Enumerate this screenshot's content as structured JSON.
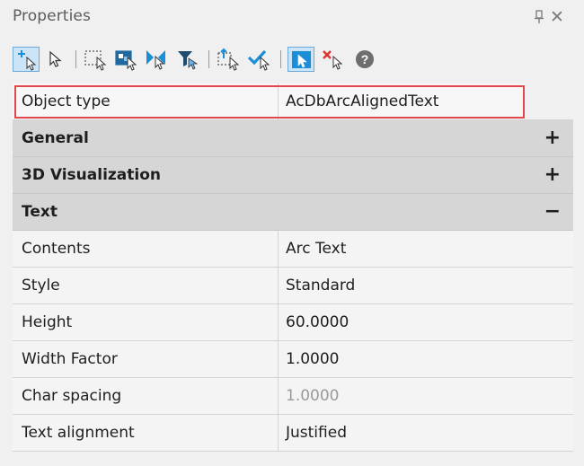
{
  "panel": {
    "title": "Properties",
    "pin_icon": "pin-icon",
    "close_label": "✕"
  },
  "toolbar": {
    "buttons": [
      {
        "name": "add-selection-icon",
        "active": false
      },
      {
        "name": "select-objects-icon",
        "active": false
      },
      {
        "name": "window-select-icon",
        "active": false
      },
      {
        "name": "crossing-select-icon",
        "active": false
      },
      {
        "name": "invert-selection-icon",
        "active": false
      },
      {
        "name": "filter-icon",
        "active": false
      },
      {
        "name": "quick-select-icon",
        "active": false
      },
      {
        "name": "select-similar-icon",
        "active": false
      },
      {
        "name": "toggle-pickadd-icon",
        "active": true
      },
      {
        "name": "deselect-icon",
        "active": false
      },
      {
        "name": "help-icon",
        "active": false
      }
    ],
    "colors": {
      "accent": "#1a8fd8",
      "filter": "#1e4c70",
      "red": "#e0302c",
      "active_bg": "#cce4f7"
    }
  },
  "object_type": {
    "label": "Object type",
    "value": "AcDbArcAlignedText"
  },
  "categories": {
    "general": {
      "label": "General",
      "toggle": "+"
    },
    "visualization": {
      "label": "3D Visualization",
      "toggle": "+"
    },
    "text": {
      "label": "Text",
      "toggle": "−"
    }
  },
  "text_props": [
    {
      "label": "Contents",
      "value": "Arc Text"
    },
    {
      "label": "Style",
      "value": "Standard"
    },
    {
      "label": "Height",
      "value": "60.0000"
    },
    {
      "label": "Width Factor",
      "value": "1.0000"
    },
    {
      "label": "Char spacing",
      "value": "1.0000",
      "disabled": true
    },
    {
      "label": "Text alignment",
      "value": "Justified"
    }
  ],
  "highlight_color": "#e0484b"
}
